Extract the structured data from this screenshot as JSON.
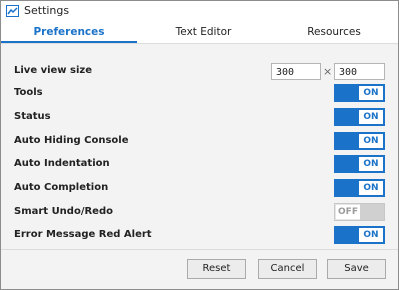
{
  "window": {
    "title": "Settings"
  },
  "tabs": [
    {
      "label": "Preferences",
      "active": true
    },
    {
      "label": "Text Editor",
      "active": false
    },
    {
      "label": "Resources",
      "active": false
    }
  ],
  "live_view": {
    "label": "Live view size",
    "width_value": "300",
    "height_value": "300",
    "separator": "×"
  },
  "settings": [
    {
      "label": "Tools",
      "state": "ON"
    },
    {
      "label": "Status",
      "state": "ON"
    },
    {
      "label": "Auto Hiding Console",
      "state": "ON"
    },
    {
      "label": "Auto Indentation",
      "state": "ON"
    },
    {
      "label": "Auto Completion",
      "state": "ON"
    },
    {
      "label": "Smart Undo/Redo",
      "state": "OFF"
    },
    {
      "label": "Error Message Red Alert",
      "state": "ON"
    }
  ],
  "buttons": {
    "reset": "Reset",
    "cancel": "Cancel",
    "save": "Save"
  },
  "colors": {
    "accent": "#1a73c9",
    "toggle_off": "#d0d0d0"
  }
}
